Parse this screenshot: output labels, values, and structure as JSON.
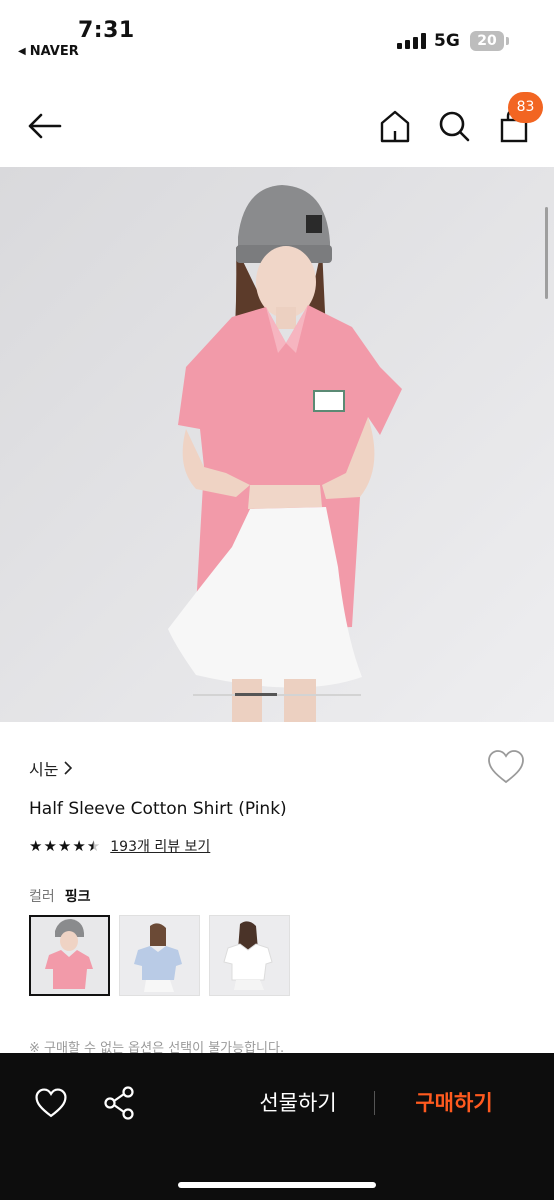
{
  "status_bar": {
    "time": "7:31",
    "back_app": "NAVER",
    "network": "5G",
    "battery": "20"
  },
  "header": {
    "icons": [
      "back-arrow-icon",
      "home-icon",
      "search-icon",
      "shopping-bag-icon"
    ],
    "cart_count": "83"
  },
  "product": {
    "brand": "시눈",
    "name": "Half Sleeve Cotton Shirt (Pink)",
    "rating": 4.5,
    "review_link": "193개 리뷰 보기",
    "color_label": "컬러",
    "color_value": "핑크",
    "swatches": [
      "pink",
      "sky blue",
      "white"
    ],
    "notice": "※ 구매할 수 없는 옵션은 선택이 불가능합니다."
  },
  "bottom_bar": {
    "gift_label": "선물하기",
    "buy_label": "구매하기",
    "buy_color": "#ff5a1f"
  },
  "colors": {
    "accent": "#f26522",
    "bar_bg": "#0d0d0d"
  }
}
